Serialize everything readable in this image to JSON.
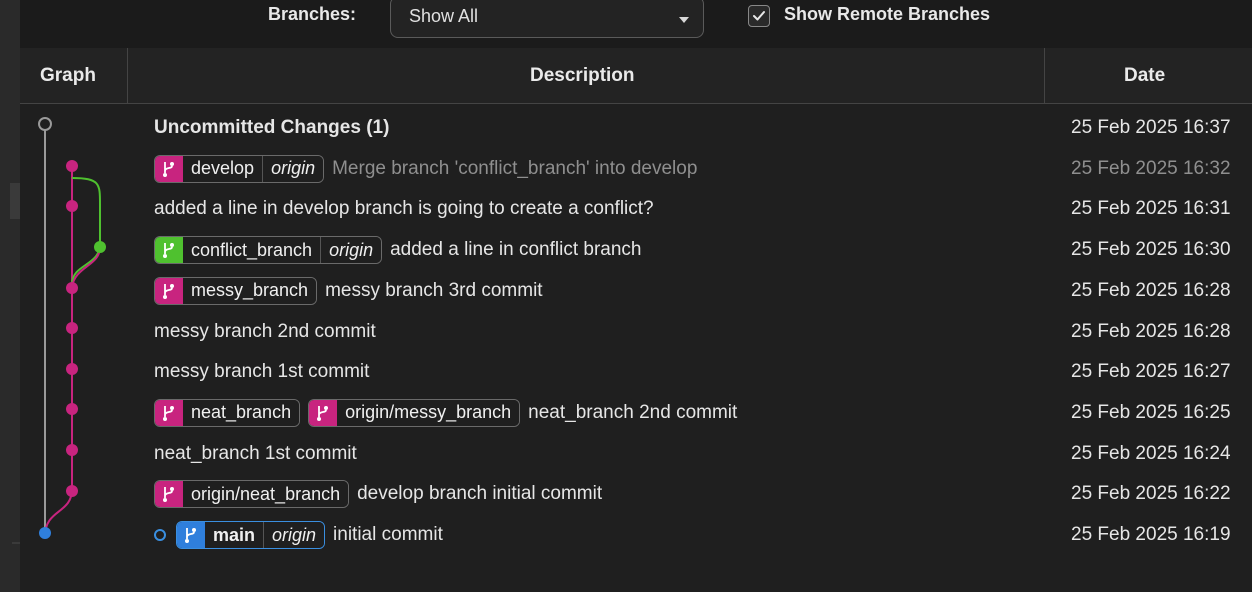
{
  "toolbar": {
    "branches_label": "Branches:",
    "branches_value": "Show All",
    "show_remote_label": "Show Remote Branches",
    "show_remote_checked": true
  },
  "columns": {
    "graph": "Graph",
    "description": "Description",
    "date": "Date"
  },
  "colors": {
    "magenta": "#c8247f",
    "green": "#4fc12f",
    "blue": "#2f7fdc",
    "gray": "#9a9a9a"
  },
  "commits": [
    {
      "message": "Uncommitted Changes (1)",
      "date": "25 Feb 2025 16:37",
      "style": "bold",
      "refs": []
    },
    {
      "message": "Merge branch 'conflict_branch' into develop",
      "date": "25 Feb 2025 16:32",
      "style": "muted",
      "refs": [
        {
          "name": "develop",
          "remote": "origin",
          "color": "magenta"
        }
      ]
    },
    {
      "message": "added a line in develop branch is going to create a conflict?",
      "date": "25 Feb 2025 16:31",
      "style": "normal",
      "refs": []
    },
    {
      "message": "added a line in conflict branch",
      "date": "25 Feb 2025 16:30",
      "style": "normal",
      "refs": [
        {
          "name": "conflict_branch",
          "remote": "origin",
          "color": "green"
        }
      ]
    },
    {
      "message": "messy branch 3rd commit",
      "date": "25 Feb 2025 16:28",
      "style": "normal",
      "refs": [
        {
          "name": "messy_branch",
          "remote": "",
          "color": "magenta"
        }
      ]
    },
    {
      "message": "messy branch 2nd commit",
      "date": "25 Feb 2025 16:28",
      "style": "normal",
      "refs": []
    },
    {
      "message": "messy branch 1st commit",
      "date": "25 Feb 2025 16:27",
      "style": "normal",
      "refs": []
    },
    {
      "message": "neat_branch 2nd commit",
      "date": "25 Feb 2025 16:25",
      "style": "normal",
      "refs": [
        {
          "name": "neat_branch",
          "remote": "",
          "color": "magenta"
        },
        {
          "name": "origin/messy_branch",
          "remote": "",
          "color": "magenta"
        }
      ]
    },
    {
      "message": "neat_branch 1st commit",
      "date": "25 Feb 2025 16:24",
      "style": "normal",
      "refs": []
    },
    {
      "message": "develop branch initial commit",
      "date": "25 Feb 2025 16:22",
      "style": "normal",
      "refs": [
        {
          "name": "origin/neat_branch",
          "remote": "",
          "color": "magenta"
        }
      ]
    },
    {
      "message": "initial commit",
      "date": "25 Feb 2025 16:19",
      "style": "normal",
      "head_marker": true,
      "refs": [
        {
          "name": "main",
          "remote": "origin",
          "color": "blue"
        }
      ]
    }
  ]
}
